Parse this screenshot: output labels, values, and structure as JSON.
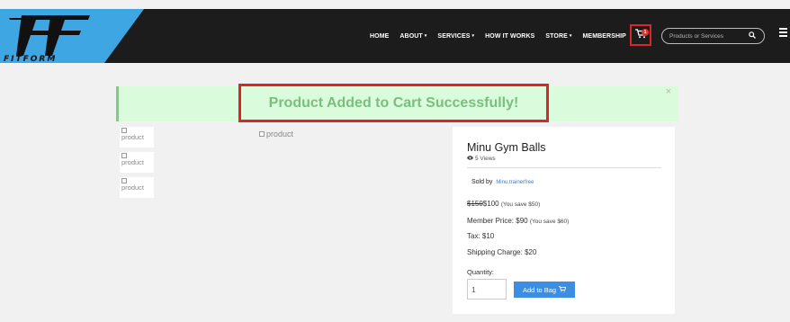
{
  "header": {
    "logo_text": "FitForm",
    "nav": [
      {
        "label": "HOME",
        "caret": ""
      },
      {
        "label": "ABOUT",
        "caret": "▾"
      },
      {
        "label": "SERVICES",
        "caret": "▾"
      },
      {
        "label": "HOW IT WORKS",
        "caret": ""
      },
      {
        "label": "STORE",
        "caret": "▾"
      },
      {
        "label": "MEMBERSHIP",
        "caret": ""
      }
    ],
    "cart_icon": "cart-icon",
    "cart_count": "1",
    "search_placeholder": "Products or Services",
    "search_icon": "search-icon",
    "menu_icon": "hamburger-menu-icon"
  },
  "alert": {
    "message": "Product Added to Cart Successfully!",
    "close": "×"
  },
  "gallery": {
    "thumbnails": [
      "product",
      "product",
      "product"
    ],
    "main_alt": "product"
  },
  "product": {
    "name": "Minu Gym Balls",
    "views": "5 Views",
    "sold_by_label": "Sold by",
    "seller": "Minu.trainerfree",
    "old_price": "$150",
    "price": "$100",
    "price_save": "(You save $50)",
    "member_label": "Member Price:",
    "member_price": "$90",
    "member_save": "(You save $60)",
    "tax_label": "Tax:",
    "tax": "$10",
    "shipping_label": "Shipping Charge:",
    "shipping": "$20",
    "quantity_label": "Quantity:",
    "quantity": "1",
    "add_button": "Add to Bag"
  },
  "colors": {
    "header_bg": "#1c1c1c",
    "logo_blue": "#3fa6e4",
    "highlight_red": "#d8262b",
    "alert_bg": "#dafbdc",
    "alert_text": "#7bbf7f",
    "button_blue": "#3b8ee2"
  }
}
